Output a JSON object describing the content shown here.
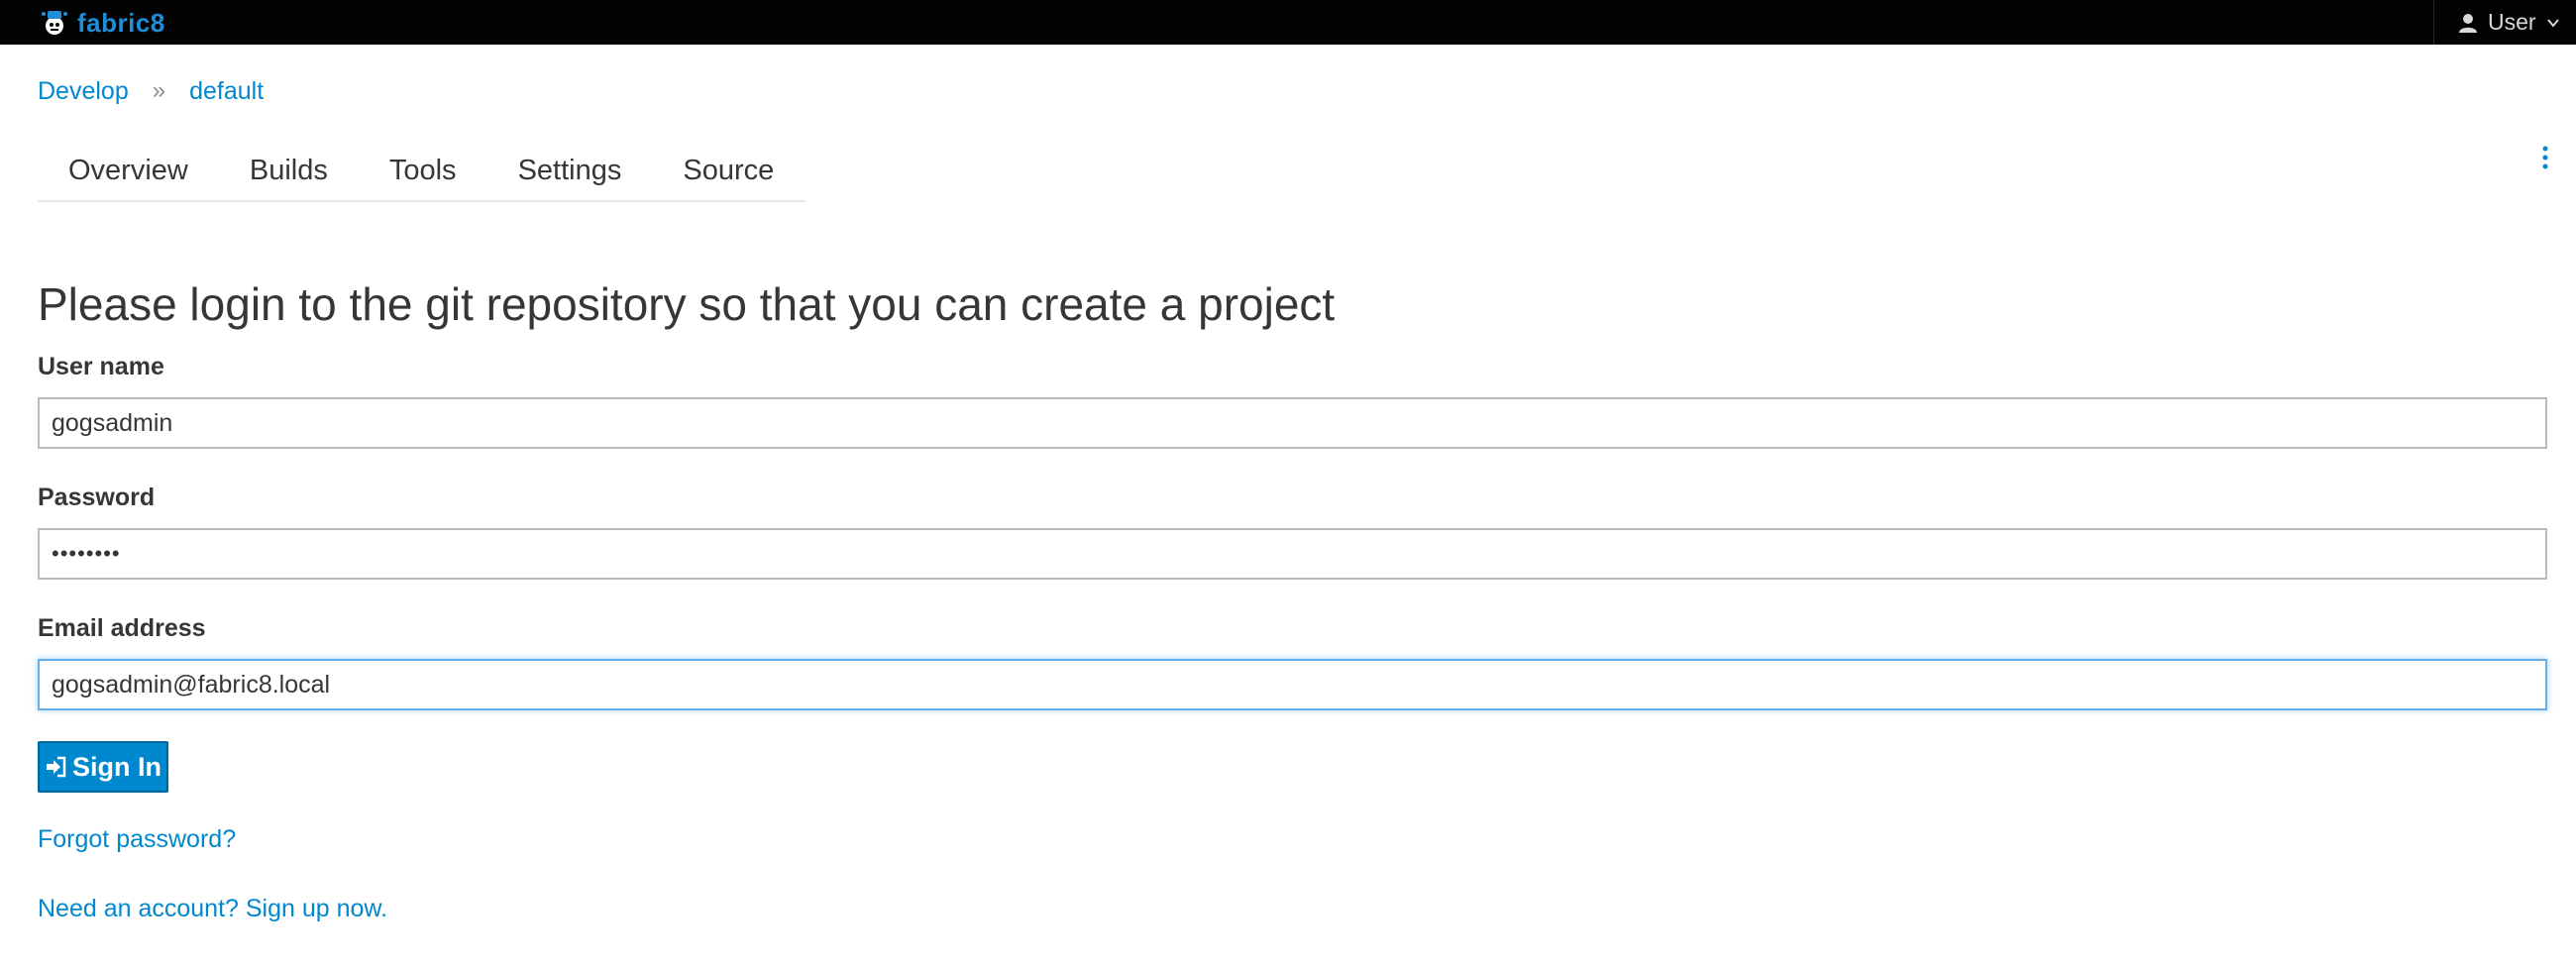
{
  "navbar": {
    "brand": "fabric8",
    "user_label": "User"
  },
  "breadcrumb": {
    "items": [
      "Develop",
      "default"
    ],
    "separator": "»"
  },
  "tabs": [
    "Overview",
    "Builds",
    "Tools",
    "Settings",
    "Source"
  ],
  "form": {
    "title": "Please login to the git repository so that you can create a project",
    "username_label": "User name",
    "username_value": "gogsadmin",
    "password_label": "Password",
    "password_value": "••••••••",
    "email_label": "Email address",
    "email_value": "gogsadmin@fabric8.local",
    "signin_label": "Sign In"
  },
  "links": {
    "forgot": "Forgot password?",
    "signup": "Need an account? Sign up now."
  },
  "colors": {
    "navbar_bg": "#030303",
    "brand": "#1e8ed8",
    "link": "#0088ce",
    "primary_button": "#0088ce",
    "focus_border": "#66afe9"
  },
  "icons": [
    "fabric8-logo-icon",
    "user-icon",
    "chevron-down-icon",
    "kebab-menu-icon",
    "sign-in-icon"
  ]
}
